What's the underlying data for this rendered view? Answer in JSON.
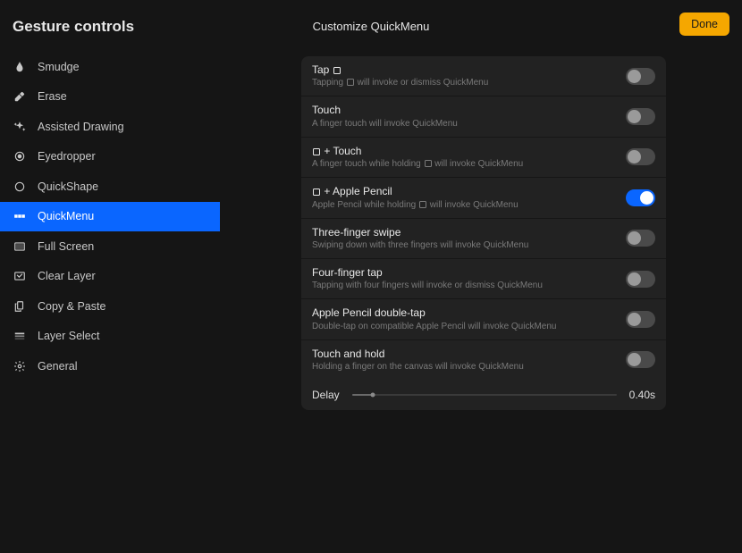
{
  "header": {
    "sidebar_title": "Gesture controls",
    "panel_title": "Customize QuickMenu",
    "done_label": "Done"
  },
  "colors": {
    "accent": "#0a66ff",
    "done": "#f5a700"
  },
  "sidebar": {
    "items": [
      {
        "id": "smudge",
        "label": "Smudge",
        "icon": "smudge-icon",
        "selected": false
      },
      {
        "id": "erase",
        "label": "Erase",
        "icon": "erase-icon",
        "selected": false
      },
      {
        "id": "assisted-drawing",
        "label": "Assisted Drawing",
        "icon": "assisted-icon",
        "selected": false
      },
      {
        "id": "eyedropper",
        "label": "Eyedropper",
        "icon": "eyedropper-icon",
        "selected": false
      },
      {
        "id": "quickshape",
        "label": "QuickShape",
        "icon": "quickshape-icon",
        "selected": false
      },
      {
        "id": "quickmenu",
        "label": "QuickMenu",
        "icon": "quickmenu-icon",
        "selected": true
      },
      {
        "id": "fullscreen",
        "label": "Full Screen",
        "icon": "fullscreen-icon",
        "selected": false
      },
      {
        "id": "clear-layer",
        "label": "Clear Layer",
        "icon": "clearlayer-icon",
        "selected": false
      },
      {
        "id": "copy-paste",
        "label": "Copy & Paste",
        "icon": "copypaste-icon",
        "selected": false
      },
      {
        "id": "layer-select",
        "label": "Layer Select",
        "icon": "layerselect-icon",
        "selected": false
      },
      {
        "id": "general",
        "label": "General",
        "icon": "gear-icon",
        "selected": false
      }
    ]
  },
  "panel": {
    "rows": [
      {
        "title_pre": "Tap ",
        "title_post": "",
        "square_in_title": true,
        "sub_pre": "Tapping ",
        "sub_post": " will invoke or dismiss QuickMenu",
        "square_in_sub": true,
        "on": false
      },
      {
        "title_pre": "Touch",
        "title_post": "",
        "square_in_title": false,
        "sub_pre": "A finger touch will invoke QuickMenu",
        "sub_post": "",
        "square_in_sub": false,
        "on": false
      },
      {
        "title_pre": "",
        "title_post": " + Touch",
        "square_in_title": true,
        "sub_pre": "A finger touch while holding ",
        "sub_post": " will invoke QuickMenu",
        "square_in_sub": true,
        "on": false
      },
      {
        "title_pre": "",
        "title_post": " + Apple Pencil",
        "square_in_title": true,
        "sub_pre": "Apple Pencil while holding ",
        "sub_post": " will invoke QuickMenu",
        "square_in_sub": true,
        "on": true
      },
      {
        "title_pre": "Three-finger swipe",
        "title_post": "",
        "square_in_title": false,
        "sub_pre": "Swiping down with three fingers will invoke QuickMenu",
        "sub_post": "",
        "square_in_sub": false,
        "on": false
      },
      {
        "title_pre": "Four-finger tap",
        "title_post": "",
        "square_in_title": false,
        "sub_pre": "Tapping with four fingers will invoke or dismiss QuickMenu",
        "sub_post": "",
        "square_in_sub": false,
        "on": false
      },
      {
        "title_pre": "Apple Pencil double-tap",
        "title_post": "",
        "square_in_title": false,
        "sub_pre": "Double-tap on compatible Apple Pencil will invoke QuickMenu",
        "sub_post": "",
        "square_in_sub": false,
        "on": false
      },
      {
        "title_pre": "Touch and hold",
        "title_post": "",
        "square_in_title": false,
        "sub_pre": "Holding a finger on the canvas will invoke QuickMenu",
        "sub_post": "",
        "square_in_sub": false,
        "on": false
      }
    ],
    "delay": {
      "label": "Delay",
      "value": "0.40s",
      "percent": 8
    }
  }
}
